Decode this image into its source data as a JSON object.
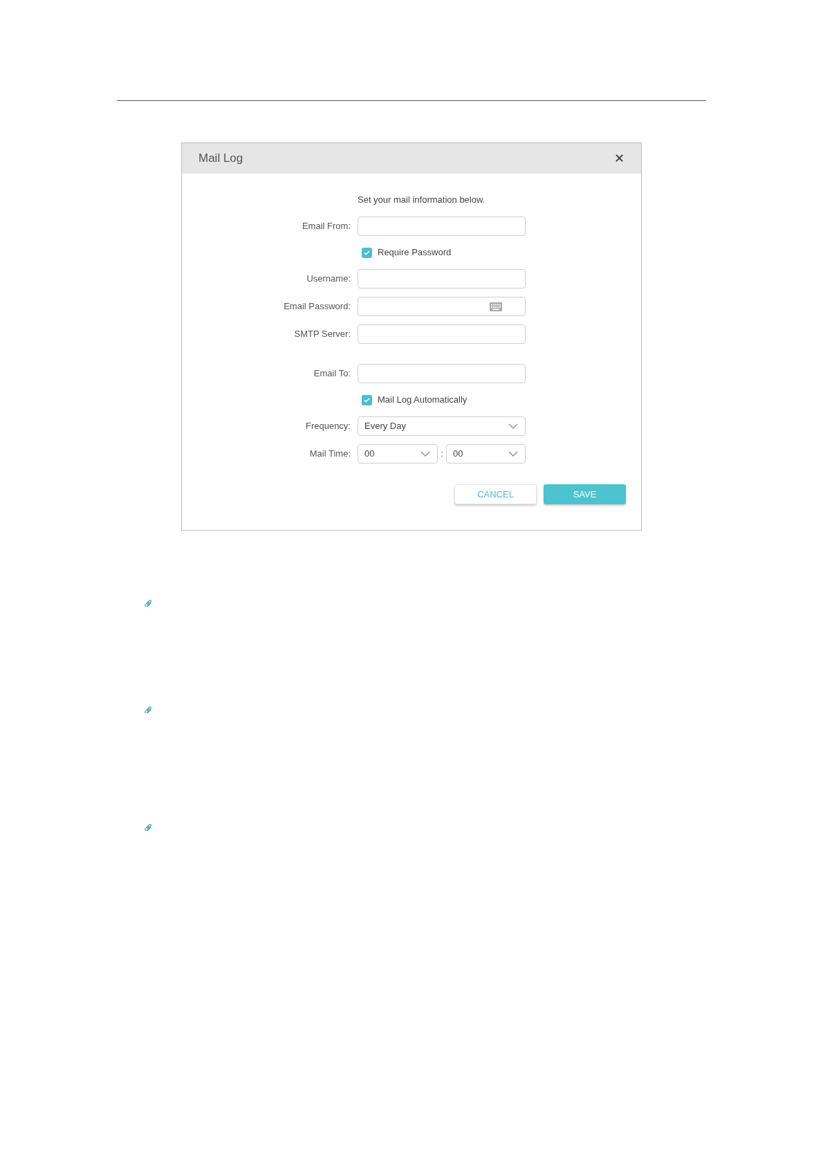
{
  "dialog": {
    "title": "Mail Log",
    "close": "✕",
    "intro": "Set your mail information below.",
    "sections": [
      [
        {
          "kind": "text",
          "label": "Email From:"
        },
        {
          "kind": "checkbox",
          "label": "Require Password",
          "checked": true
        },
        {
          "kind": "text",
          "label": "Username:"
        },
        {
          "kind": "password",
          "label": "Email Password:"
        },
        {
          "kind": "text",
          "label": "SMTP Server:"
        }
      ],
      [
        {
          "kind": "text",
          "label": "Email To:"
        },
        {
          "kind": "checkbox",
          "label": "Mail Log Automatically",
          "checked": true
        },
        {
          "kind": "select",
          "label": "Frequency:",
          "value": "Every Day"
        },
        {
          "kind": "time",
          "label": "Mail Time:",
          "hour": "00",
          "separator": ":",
          "minute": "00"
        }
      ]
    ],
    "buttons": [
      {
        "kind": "secondary",
        "label": "CANCEL"
      },
      {
        "kind": "primary",
        "label": "SAVE"
      }
    ]
  }
}
